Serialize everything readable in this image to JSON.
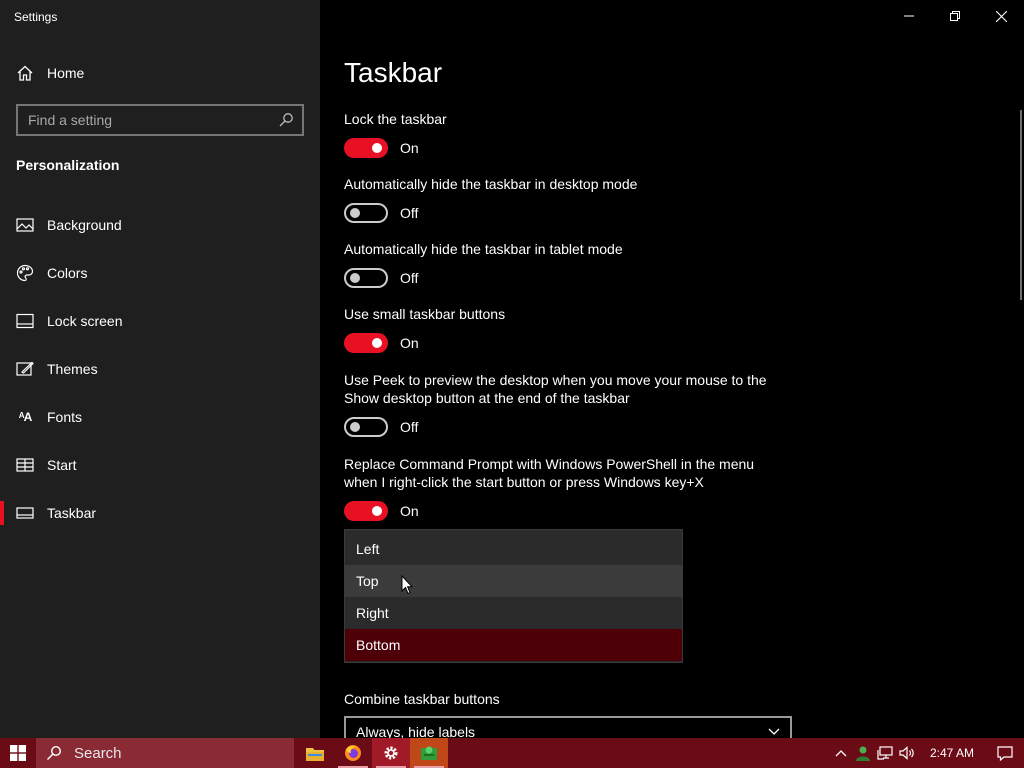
{
  "window": {
    "title": "Settings"
  },
  "sidebar": {
    "home_label": "Home",
    "search_placeholder": "Find a setting",
    "section_title": "Personalization",
    "items": [
      {
        "label": "Background",
        "icon": "picture-icon"
      },
      {
        "label": "Colors",
        "icon": "palette-icon"
      },
      {
        "label": "Lock screen",
        "icon": "lock-screen-icon"
      },
      {
        "label": "Themes",
        "icon": "brush-icon"
      },
      {
        "label": "Fonts",
        "icon": "fonts-icon"
      },
      {
        "label": "Start",
        "icon": "start-grid-icon"
      },
      {
        "label": "Taskbar",
        "icon": "taskbar-icon",
        "active": true
      }
    ]
  },
  "main": {
    "title": "Taskbar",
    "settings": [
      {
        "label": "Lock the taskbar",
        "state": "On"
      },
      {
        "label": "Automatically hide the taskbar in desktop mode",
        "state": "Off"
      },
      {
        "label": "Automatically hide the taskbar in tablet mode",
        "state": "Off"
      },
      {
        "label": "Use small taskbar buttons",
        "state": "On"
      },
      {
        "label": "Use Peek to preview the desktop when you move your mouse to the Show desktop button at the end of the taskbar",
        "state": "Off"
      },
      {
        "label": "Replace Command Prompt with Windows PowerShell in the menu when I right-click the start button or press Windows key+X",
        "state": "On"
      }
    ],
    "location_dropdown": {
      "options": [
        "Left",
        "Top",
        "Right",
        "Bottom"
      ],
      "hovered": "Top",
      "selected": "Bottom"
    },
    "combine": {
      "label": "Combine taskbar buttons",
      "value": "Always, hide labels"
    }
  },
  "taskbar": {
    "search_label": "Search",
    "clock": "2:47 AM",
    "apps": [
      "file-explorer-icon",
      "firefox-icon",
      "settings-gear-icon",
      "green-app-icon"
    ]
  },
  "colors": {
    "accent": "#e81123",
    "taskbar": "#6b0b16",
    "selected": "#4e0009"
  }
}
